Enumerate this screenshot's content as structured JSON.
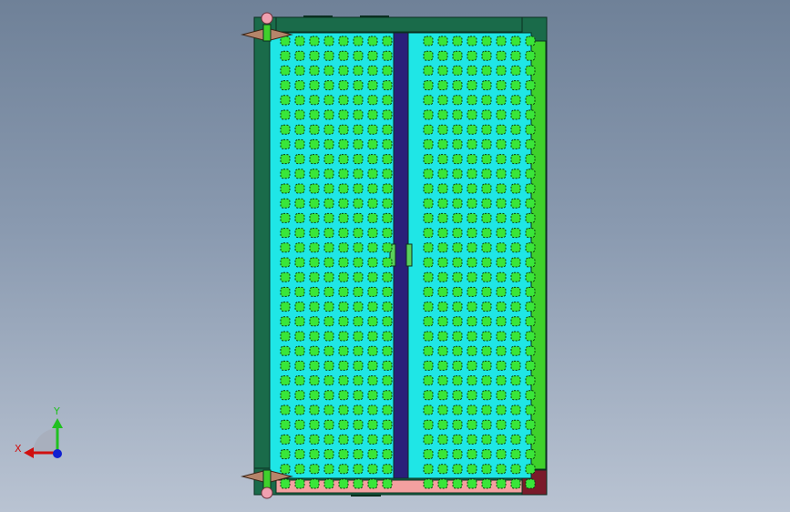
{
  "viewport": {
    "background_top": "#6f8198",
    "background_bottom": "#b9c3d2"
  },
  "model": {
    "description_icon": "cad-assembly-door-panel",
    "grid": {
      "rows": 31,
      "cols_per_panel": 8,
      "hole_color": "#39e639",
      "hole_outline": "#0a3d0a",
      "panel_fill": "#1fe6e6"
    },
    "colors": {
      "outer_frame": "#1a6b4a",
      "right_rail": "#3fd12b",
      "center_mullion": "#2a1f7a",
      "bottom_strip": "#f4a0a0",
      "bottom_right_block": "#7a1a2a",
      "top_right_block": "#1a6b4a",
      "hinge_cone": "#b5856a",
      "hinge_ball": "#f0a0b0",
      "handle": "#5ad15a"
    }
  },
  "triad": {
    "x_label": "X",
    "y_label": "Y",
    "x_color": "#d01010",
    "y_color": "#20c020",
    "z_color": "#1020d0"
  }
}
